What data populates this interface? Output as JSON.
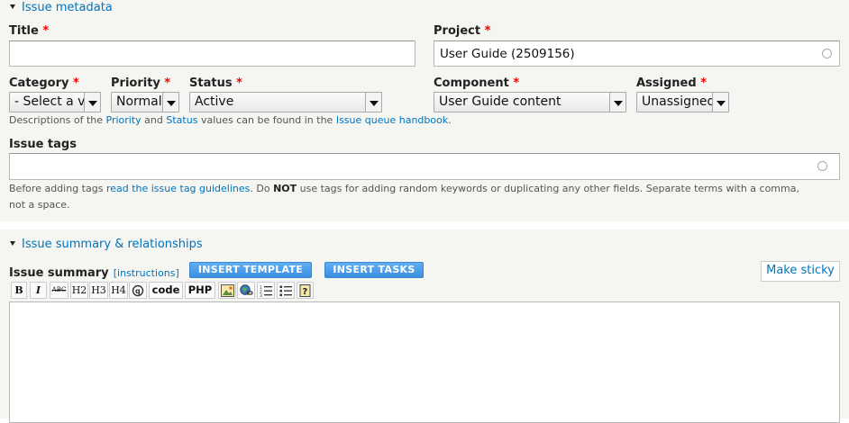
{
  "metadata_section": {
    "legend": "Issue metadata",
    "title_label": "Title",
    "title_value": "",
    "project_label": "Project",
    "project_value": "User Guide (2509156)",
    "category_label": "Category",
    "category_value": "- Select a va",
    "priority_label": "Priority",
    "priority_value": "Normal",
    "status_label": "Status",
    "status_value": "Active",
    "component_label": "Component",
    "component_value": "User Guide content",
    "assigned_label": "Assigned",
    "assigned_value": "Unassigned",
    "required_marker": "*",
    "desc": {
      "part1": "Descriptions of the ",
      "priority_link": "Priority",
      "part2": " and ",
      "status_link": "Status",
      "part3": " values can be found in the ",
      "handbook_link": "Issue queue handbook",
      "part4": "."
    },
    "tags_label": "Issue tags",
    "tags_value": "",
    "tags_help": {
      "part1": "Before adding tags ",
      "guidelines_link": "read the issue tag guidelines",
      "part2": ". Do ",
      "not": "NOT",
      "part3": " use tags for adding random keywords or duplicating any other fields. Separate terms with a comma,",
      "line2": "not a space."
    }
  },
  "summary_section": {
    "legend": "Issue summary & relationships",
    "summary_label": "Issue summary",
    "instructions_link": "[instructions]",
    "insert_template": "INSERT TEMPLATE",
    "insert_tasks": "INSERT TASKS",
    "make_sticky": "Make sticky",
    "toolbar": {
      "bold": "B",
      "italic": "I",
      "strike": "ABC",
      "h2": "H2",
      "h3": "H3",
      "h4": "H4",
      "code": "code",
      "php": "PHP"
    },
    "body_value": ""
  },
  "colors": {
    "link": "#0074bd",
    "required": "#e00000",
    "button_blue": "#3c8de0",
    "panel_bg": "#f5f5f2"
  }
}
